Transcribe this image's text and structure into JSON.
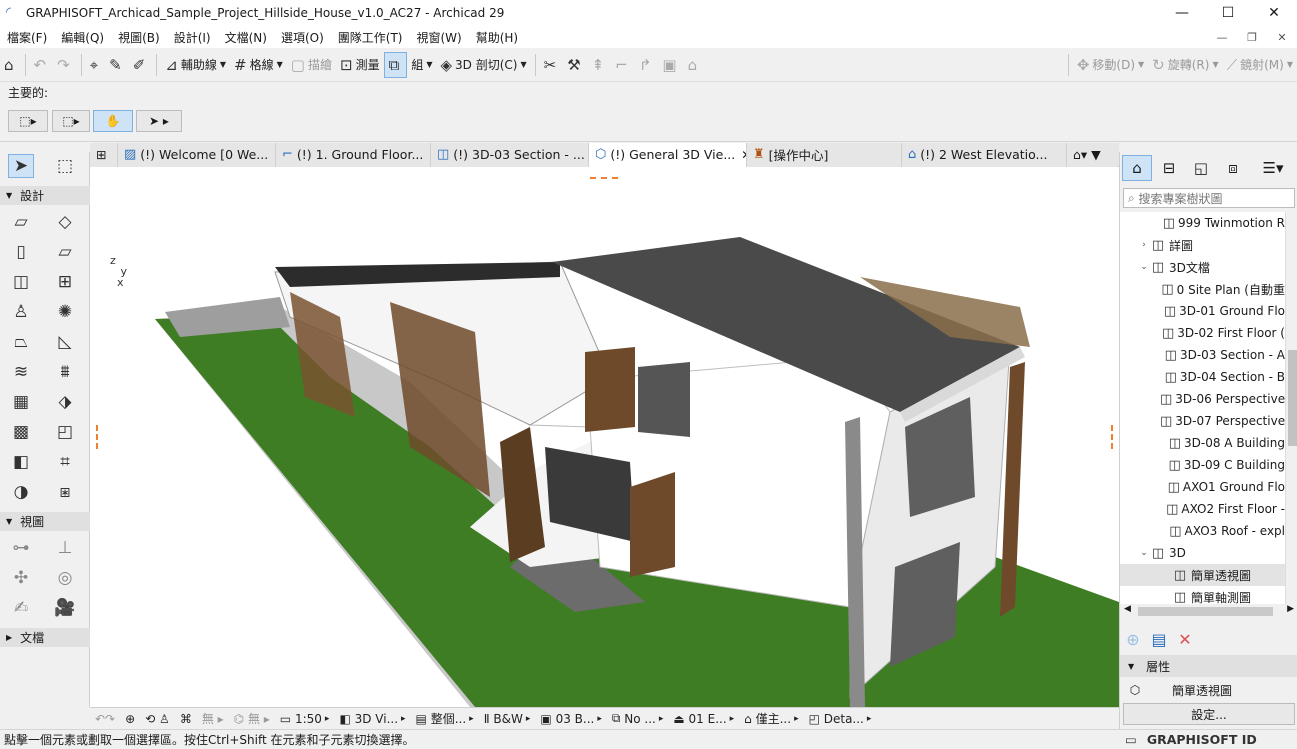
{
  "app": {
    "title": "GRAPHISOFT_Archicad_Sample_Project_Hillside_House_v1.0_AC27 - Archicad 29",
    "win_minimize": "—",
    "win_maximize": "☐",
    "win_close": "✕"
  },
  "menu": [
    "檔案(F)",
    "編輯(Q)",
    "視圖(B)",
    "設計(I)",
    "文檔(N)",
    "選項(O)",
    "團隊工作(T)",
    "視窗(W)",
    "幫助(H)"
  ],
  "toolbar": {
    "aux_lines": "輔助線",
    "grid": "格線",
    "snap": "描繪",
    "measure": "測量",
    "group": "組",
    "cut3d": "3D 剖切(C)",
    "move": "移動(D)",
    "rotate": "旋轉(R)",
    "mirror": "鏡射(M)"
  },
  "info_box": {
    "label": "主要的:"
  },
  "tabs": [
    {
      "label": "(!) Welcome [0 We..."
    },
    {
      "label": "(!) 1. Ground Floor..."
    },
    {
      "label": "(!) 3D-03 Section - ..."
    },
    {
      "label": "(!) General 3D Vie..."
    },
    {
      "label": "[操作中心]"
    },
    {
      "label": "(!) 2 West Elevatio..."
    }
  ],
  "toolbox": {
    "design": "設計",
    "view": "視圖",
    "document": "文檔"
  },
  "bottom_bar": {
    "scale": "1:50",
    "view3d": "3D Vi...",
    "struct": "整個...",
    "pens": "B&W",
    "layer": "03 B...",
    "override": "No ...",
    "floor": "01 E...",
    "renovation": "僅主...",
    "detail": "Deta..."
  },
  "status": {
    "text": "點擊一個元素或劃取一個選擇區。按住Ctrl+Shift 在元素和子元素切換選擇。"
  },
  "navigator": {
    "search_placeholder": "搜索專案樹狀圖",
    "properties_header": "層性",
    "selected_view": "簡單透視圖",
    "settings_button": "設定...",
    "tree": [
      {
        "label": "999 Twinmotion R",
        "indent": 2,
        "expand": ""
      },
      {
        "label": "詳圖",
        "indent": 1,
        "expand": "›"
      },
      {
        "label": "3D文檔",
        "indent": 1,
        "expand": "⌄"
      },
      {
        "label": "0 Site Plan (自動重",
        "indent": 2,
        "expand": ""
      },
      {
        "label": "3D-01 Ground Flo",
        "indent": 2,
        "expand": ""
      },
      {
        "label": "3D-02 First Floor (",
        "indent": 2,
        "expand": ""
      },
      {
        "label": "3D-03 Section - A",
        "indent": 2,
        "expand": ""
      },
      {
        "label": "3D-04 Section - B",
        "indent": 2,
        "expand": ""
      },
      {
        "label": "3D-06 Perspective",
        "indent": 2,
        "expand": ""
      },
      {
        "label": "3D-07 Perspective",
        "indent": 2,
        "expand": ""
      },
      {
        "label": "3D-08 A Building",
        "indent": 2,
        "expand": ""
      },
      {
        "label": "3D-09 C Building",
        "indent": 2,
        "expand": ""
      },
      {
        "label": "AXO1 Ground Flo",
        "indent": 2,
        "expand": ""
      },
      {
        "label": "AXO2 First Floor -",
        "indent": 2,
        "expand": ""
      },
      {
        "label": "AXO3 Roof - expl",
        "indent": 2,
        "expand": ""
      },
      {
        "label": "3D",
        "indent": 1,
        "expand": "⌄"
      },
      {
        "label": "簡單透視圖",
        "indent": 2,
        "expand": ""
      },
      {
        "label": "簡單軸測圖",
        "indent": 2,
        "expand": ""
      }
    ]
  },
  "gs_id": "GRAPHISOFT ID"
}
